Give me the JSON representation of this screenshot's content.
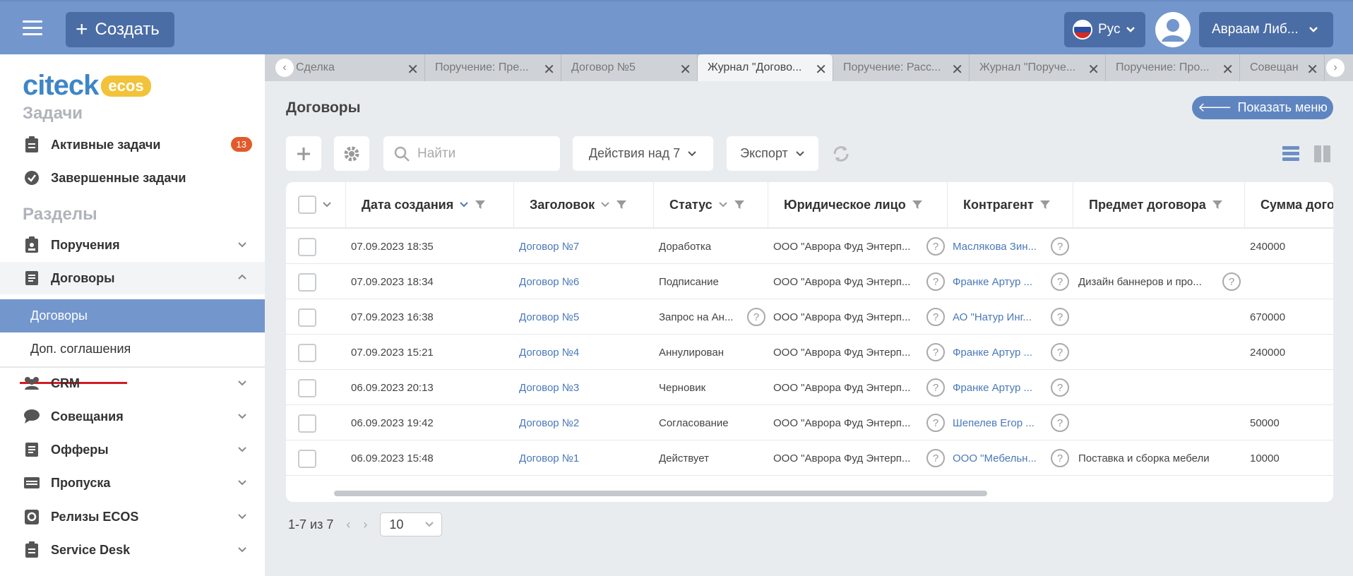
{
  "header": {
    "create_label": "Создать",
    "lang_label": "Рус",
    "user_name": "Авраам Либ..."
  },
  "sidebar": {
    "logo_main": "citeck",
    "logo_badge": "ecos",
    "tasks_title": "Задачи",
    "active_tasks": "Активные задачи",
    "active_tasks_count": "13",
    "done_tasks": "Завершенные задачи",
    "sections_title": "Разделы",
    "items": [
      {
        "label": "Поручения"
      },
      {
        "label": "Договоры"
      },
      {
        "label": "Договоры"
      },
      {
        "label": "Доп. соглашения"
      },
      {
        "label": "CRM"
      },
      {
        "label": "Совещания"
      },
      {
        "label": "Офферы"
      },
      {
        "label": "Пропуска"
      },
      {
        "label": "Релизы ECOS"
      },
      {
        "label": "Service Desk"
      }
    ]
  },
  "tabs": [
    {
      "label": "Сделка"
    },
    {
      "label": "Поручение: Пре..."
    },
    {
      "label": "Договор №5"
    },
    {
      "label": "Журнал \"Догово..."
    },
    {
      "label": "Поручение: Расс..."
    },
    {
      "label": "Журнал \"Поруче..."
    },
    {
      "label": "Поручение: Про..."
    },
    {
      "label": "Совещан"
    }
  ],
  "page": {
    "title": "Договоры",
    "show_menu": "Показать меню"
  },
  "toolbar": {
    "search_placeholder": "Найти",
    "actions_label": "Действия над 7",
    "export_label": "Экспорт"
  },
  "table": {
    "columns": [
      "Дата создания",
      "Заголовок",
      "Статус",
      "Юридическое лицо",
      "Контрагент",
      "Предмет договора",
      "Сумма дого"
    ],
    "rows": [
      {
        "date": "07.09.2023 18:35",
        "title": "Договор №7",
        "status": "Доработка",
        "legal": "ООО \"Аврора Фуд Энтерп...",
        "counterparty": "Маслякова Зин...",
        "subject": "",
        "sum": "240000"
      },
      {
        "date": "07.09.2023 18:34",
        "title": "Договор №6",
        "status": "Подписание",
        "legal": "ООО \"Аврора Фуд Энтерп...",
        "counterparty": "Франке Артур ...",
        "subject": "Дизайн баннеров и про...",
        "sum": ""
      },
      {
        "date": "07.09.2023 16:38",
        "title": "Договор №5",
        "status": "Запрос на Ан...",
        "legal": "ООО \"Аврора Фуд Энтерп...",
        "counterparty": "АО \"Натур Инг...",
        "subject": "",
        "sum": "670000"
      },
      {
        "date": "07.09.2023 15:21",
        "title": "Договор №4",
        "status": "Аннулирован",
        "legal": "ООО \"Аврора Фуд Энтерп...",
        "counterparty": "Франке Артур ...",
        "subject": "",
        "sum": "240000"
      },
      {
        "date": "06.09.2023 20:13",
        "title": "Договор №3",
        "status": "Черновик",
        "legal": "ООО \"Аврора Фуд Энтерп...",
        "counterparty": "Франке Артур ...",
        "subject": "",
        "sum": ""
      },
      {
        "date": "06.09.2023 19:42",
        "title": "Договор №2",
        "status": "Согласование",
        "legal": "ООО \"Аврора Фуд Энтерп...",
        "counterparty": "Шепелев Егор ...",
        "subject": "",
        "sum": "50000"
      },
      {
        "date": "06.09.2023 15:48",
        "title": "Договор №1",
        "status": "Действует",
        "legal": "ООО \"Аврора Фуд Энтерп...",
        "counterparty": "ООО \"Мебельн...",
        "subject": "Поставка и сборка мебели",
        "sum": "10000"
      }
    ]
  },
  "pager": {
    "range": "1-7 из 7",
    "page_size": "10"
  },
  "colors": {
    "topbar": "#7396cd",
    "button": "#4b6da6",
    "accent": "#4a78b9",
    "badge": "#e25a2b"
  }
}
